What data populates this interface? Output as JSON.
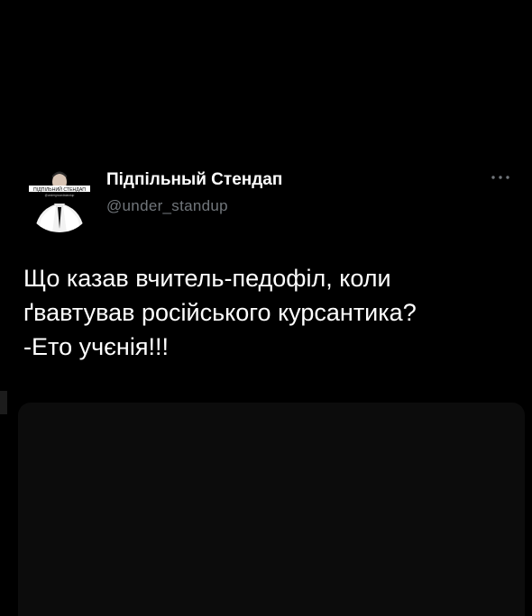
{
  "tweet": {
    "display_name": "Підпільный Стендап",
    "handle": "@under_standup",
    "text": "Що казав вчитель-педофіл, коли\nґвавтував російського курсантика?\n-Ето учєнія!!!",
    "avatar_caption": "ПІДПІЛЬНИЙ СТЕНДАП",
    "avatar_subcaption": "@undergroundstandup"
  },
  "icons": {
    "more": "more-horizontal-icon"
  },
  "colors": {
    "background": "#000000",
    "name": "#ffffff",
    "handle": "#71767b",
    "text": "#ffffff"
  }
}
